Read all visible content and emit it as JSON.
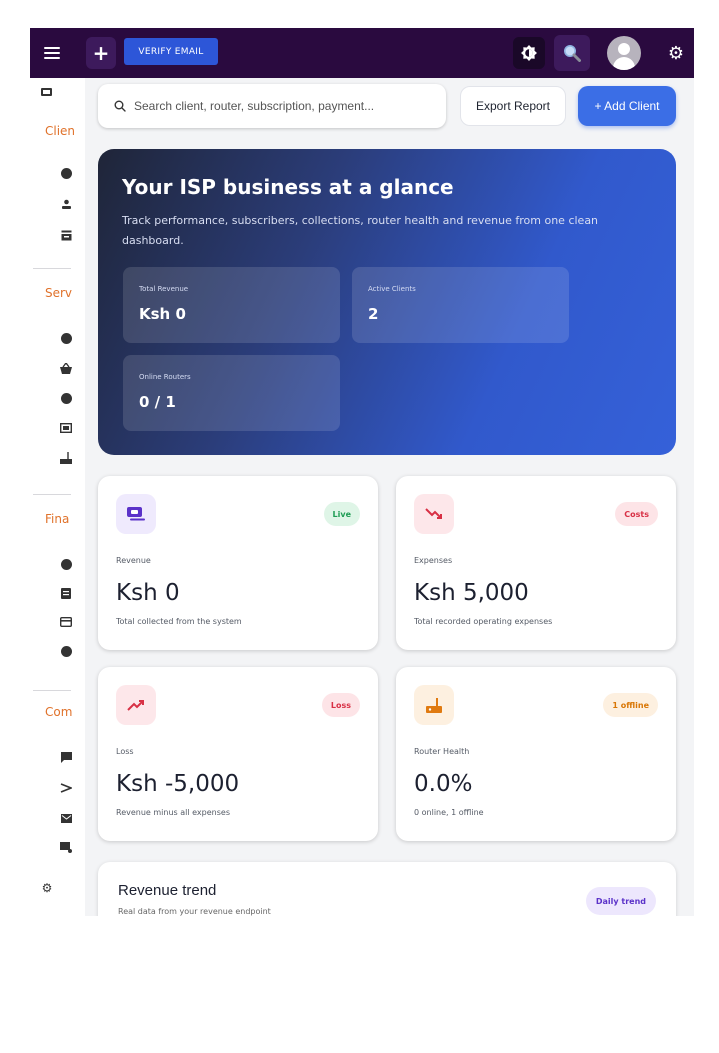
{
  "topbar": {
    "verify_label": "VERIFY EMAIL",
    "plus_label": "+",
    "gear_label": "⚙"
  },
  "sidebar": {
    "sections": [
      "Clien",
      "Serv",
      "Fina",
      "Com"
    ],
    "icons": [
      "laptop-icon",
      "plus-circle-icon",
      "user-icon",
      "inbox-icon",
      "plus-circle-icon",
      "basket-icon",
      "plus-circle-icon",
      "cash-icon",
      "router-icon",
      "plus-circle-icon",
      "list-icon",
      "credit-card-icon",
      "alert-icon",
      "chat-icon",
      "send-icon",
      "mail-icon",
      "mail-settings-icon",
      "settings-icon"
    ]
  },
  "search": {
    "placeholder": "Search client, router, subscription, payment..."
  },
  "actions": {
    "export_label": "Export Report",
    "add_label": "+ Add Client"
  },
  "hero": {
    "title": "Your ISP business at a glance",
    "subtitle": "Track performance, subscribers, collections, router health and revenue from one clean dashboard.",
    "stats": [
      {
        "label": "Total Revenue",
        "value": "Ksh 0"
      },
      {
        "label": "Active Clients",
        "value": "2"
      },
      {
        "label": "Online Routers",
        "value": "0 / 1"
      }
    ]
  },
  "cards": [
    {
      "icon": "wallet-icon",
      "badge": "Live",
      "label": "Revenue",
      "value": "Ksh 0",
      "desc": "Total collected from the system",
      "badge_color": "#1f9d55",
      "badge_bg": "#dff5e7",
      "icon_bg": "#efeafd",
      "icon_color": "#5b32c9"
    },
    {
      "icon": "trend-down-icon",
      "badge": "Costs",
      "label": "Expenses",
      "value": "Ksh 5,000",
      "desc": "Total recorded operating expenses",
      "badge_color": "#d83045",
      "badge_bg": "#fde4e7",
      "icon_bg": "#fde7ea",
      "icon_color": "#d83045"
    },
    {
      "icon": "trend-up-icon",
      "badge": "Loss",
      "label": "Loss",
      "value": "Ksh -5,000",
      "desc": "Revenue minus all expenses",
      "badge_color": "#d83045",
      "badge_bg": "#fde4e7",
      "icon_bg": "#fde7ea",
      "icon_color": "#d83045"
    },
    {
      "icon": "router-icon",
      "badge": "1 offline",
      "label": "Router Health",
      "value": "0.0%",
      "desc": "0 online, 1 offline",
      "badge_color": "#d97706",
      "badge_bg": "#fdf0e0",
      "icon_bg": "#fdf0e0",
      "icon_color": "#e07a10"
    }
  ],
  "trend": {
    "title": "Revenue trend",
    "subtitle": "Real data from your revenue endpoint",
    "badge": "Daily trend"
  }
}
